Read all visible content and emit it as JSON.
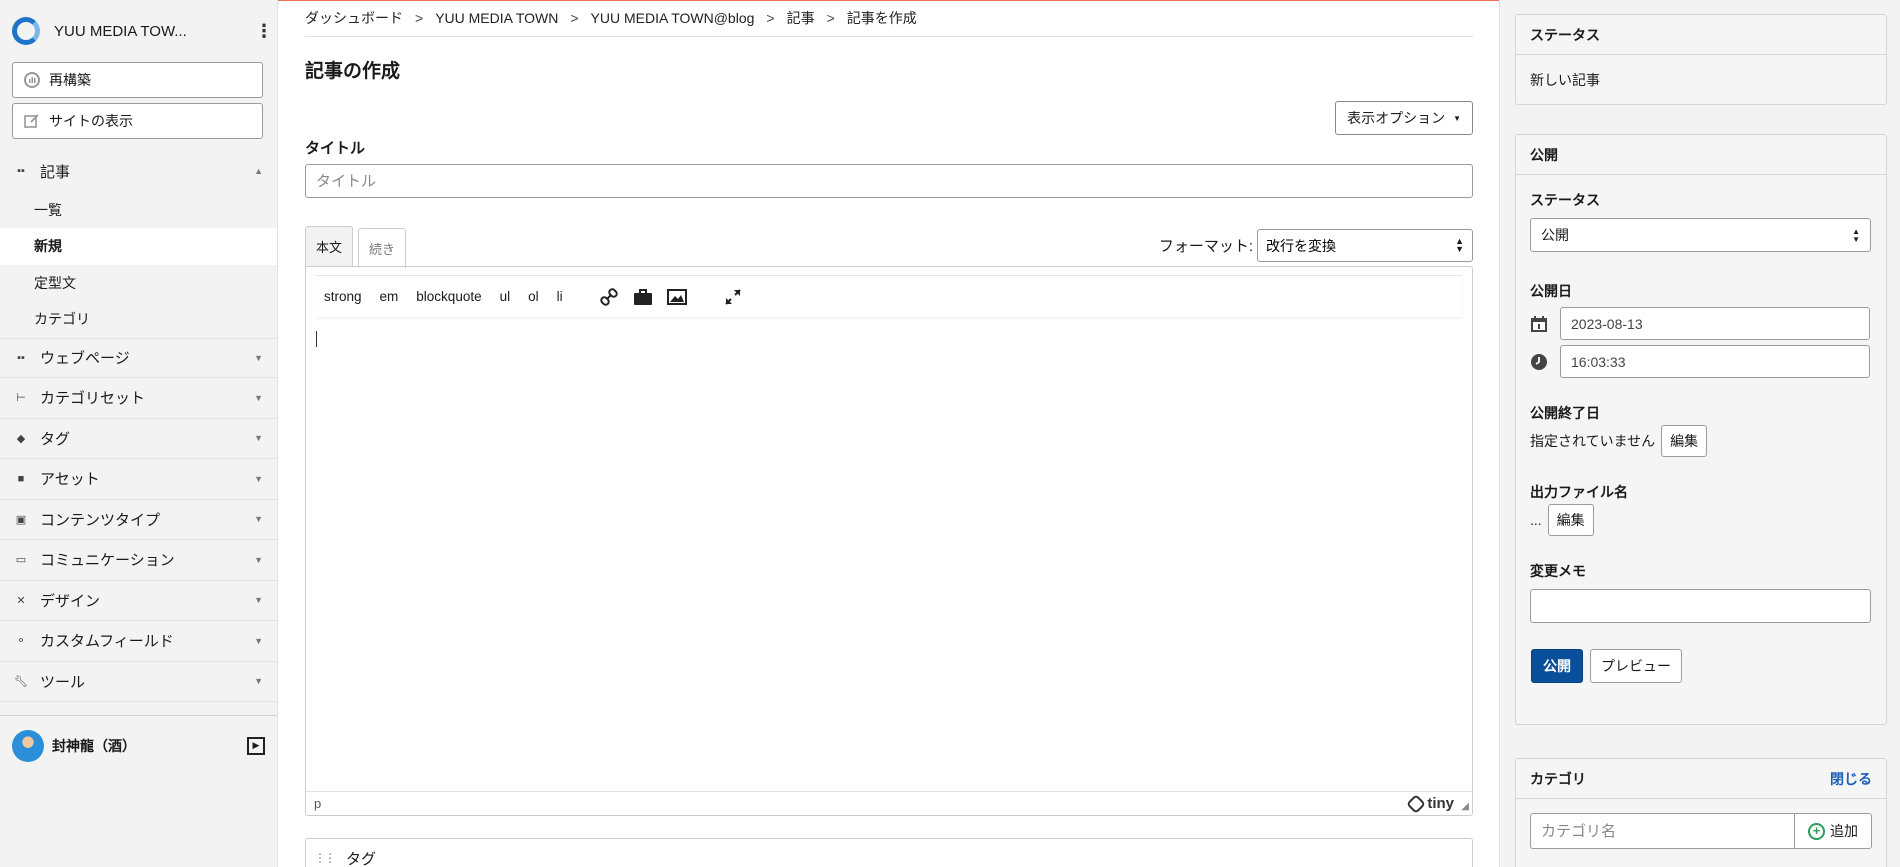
{
  "sidebar": {
    "site_name": "YUU MEDIA TOW...",
    "rebuild_label": "再構築",
    "view_site_label": "サイトの表示",
    "nav": {
      "articles": "記事",
      "articles_sub": [
        "一覧",
        "新規",
        "定型文",
        "カテゴリ"
      ],
      "webpages": "ウェブページ",
      "category_sets": "カテゴリセット",
      "tags": "タグ",
      "assets": "アセット",
      "content_types": "コンテンツタイプ",
      "communication": "コミュニケーション",
      "design": "デザイン",
      "custom_fields": "カスタムフィールド",
      "tools": "ツール"
    },
    "user_name": "封神龍（酒）"
  },
  "breadcrumb": [
    "ダッシュボード",
    "YUU MEDIA TOWN",
    "YUU MEDIA TOWN@blog",
    "記事",
    "記事を作成"
  ],
  "breadcrumb_sep": ">",
  "page_title": "記事の作成",
  "display_options_label": "表示オプション",
  "title_field": {
    "label": "タイトル",
    "placeholder": "タイトル",
    "value": ""
  },
  "editor": {
    "tabs": [
      "本文",
      "続き"
    ],
    "format_label": "フォーマット:",
    "format_value": "改行を変換",
    "toolbar": [
      "strong",
      "em",
      "blockquote",
      "ul",
      "ol",
      "li"
    ],
    "status_path": "p",
    "brand": "tiny"
  },
  "tags_section_label": "タグ",
  "status_card": {
    "title": "ステータス",
    "value": "新しい記事"
  },
  "publish_card": {
    "title": "公開",
    "status_label": "ステータス",
    "status_value": "公開",
    "date_label": "公開日",
    "date_value": "2023-08-13",
    "time_value": "16:03:33",
    "end_label": "公開終了日",
    "end_value": "指定されていません",
    "edit_label": "編集",
    "filename_label": "出力ファイル名",
    "filename_value": "...",
    "memo_label": "変更メモ",
    "publish_btn": "公開",
    "preview_btn": "プレビュー"
  },
  "category_card": {
    "title": "カテゴリ",
    "close_label": "閉じる",
    "input_placeholder": "カテゴリ名",
    "add_label": "追加"
  },
  "colors": {
    "primary": "#0a4f9a",
    "link": "#1a5fb4",
    "accent_line": "#e8705a",
    "add": "#2a9d5c"
  }
}
